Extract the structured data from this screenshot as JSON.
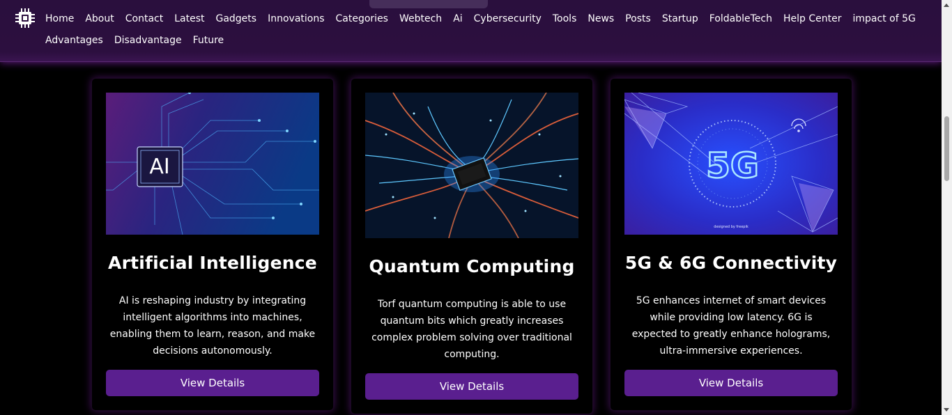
{
  "nav": {
    "links": [
      "Home",
      "About",
      "Contact",
      "Latest",
      "Gadgets",
      "Innovations",
      "Categories",
      "Webtech",
      "Ai",
      "Cybersecurity",
      "Tools",
      "News",
      "Posts",
      "Startup",
      "FoldableTech",
      "Help Center",
      "impact of 5G",
      "Advantages",
      "Disadvantage",
      "Future"
    ]
  },
  "cards": [
    {
      "title": "Artificial Intelligence",
      "description": "AI is reshaping industry by integrating intelligent algorithms into machines, enabling them to learn, reason, and make decisions autonomously.",
      "button": "View Details",
      "image_text": "AI"
    },
    {
      "title": "Quantum Computing",
      "description": "Torf quantum computing is able to use quantum bits which greatly increases complex problem solving over traditional computing.",
      "button": "View Details"
    },
    {
      "title": "5G & 6G Connectivity",
      "description": "5G enhances internet of smart devices while providing low latency. 6G is expected to greatly enhance holograms, ultra-immersive experiences.",
      "button": "View Details",
      "image_text": "5G",
      "image_credit": "designed by freepik"
    }
  ],
  "colors": {
    "nav_bg": "#2c0f3f",
    "button": "#5a1f8f",
    "page_bg": "#000000"
  }
}
